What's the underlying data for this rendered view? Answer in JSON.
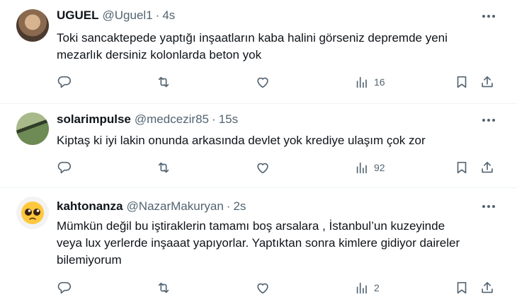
{
  "tweets": [
    {
      "name": "UGUEL",
      "handle": "@Uguel1",
      "separator": "·",
      "time": "4s",
      "text_lines": [
        "Toki sancaktepede yaptığı inşaatların kaba halini görseniz depremde yeni",
        "mezarlık dersiniz kolonlarda beton yok"
      ],
      "views": "16",
      "avatar_colors": [
        "#4b3a2f",
        "#8a6a4e",
        "#d7b48f"
      ]
    },
    {
      "name": "solarimpulse",
      "handle": "@medcezir85",
      "separator": "·",
      "time": "15s",
      "text_lines": [
        "Kiptaş ki iyi lakin onunda arkasında devlet yok krediye ulaşım çok zor"
      ],
      "views": "92",
      "avatar_colors": [
        "#6e8a55",
        "#a8b98a",
        "#2f3d28"
      ]
    },
    {
      "name": "kahtonanza",
      "handle": "@NazarMakuryan",
      "separator": "·",
      "time": "2s",
      "text_lines": [
        "Mümkün değil bu iştiraklerin tamamı boş arsalara , İstanbul’un kuzeyinde",
        "veya lux yerlerde inşaaat yapıyorlar. Yaptıktan sonra kimlere gidiyor daireler",
        "bilemiyorum"
      ],
      "views": "2",
      "avatar_colors": [
        "#f3f3f3",
        "#ffc83d",
        "#6b3a14"
      ]
    }
  ],
  "icons": [
    "reply-icon",
    "retweet-icon",
    "like-icon",
    "views-icon",
    "bookmark-icon",
    "share-icon",
    "more-icon"
  ],
  "colors": {
    "text": "#0f1419",
    "secondary": "#536471",
    "divider": "#eff3f4"
  }
}
